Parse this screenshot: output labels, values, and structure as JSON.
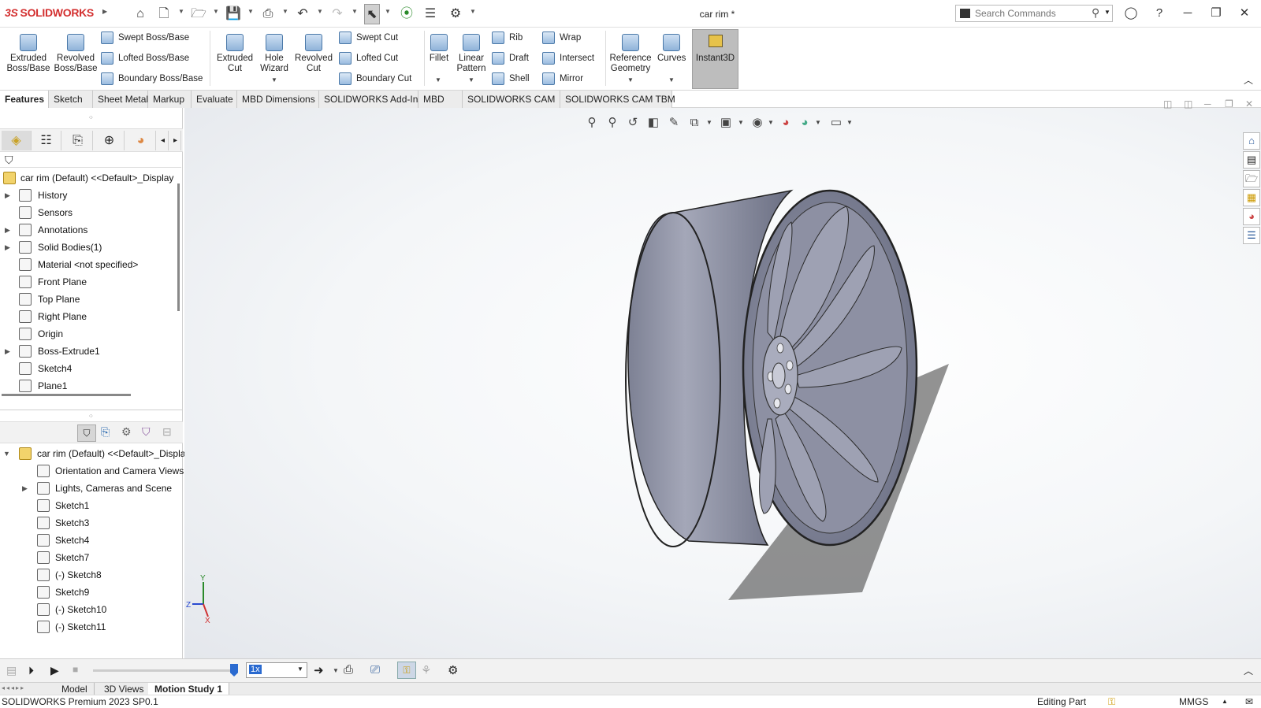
{
  "app": {
    "brand": "SOLIDWORKS",
    "document_title": "car rim *"
  },
  "search": {
    "placeholder": "Search Commands"
  },
  "ribbon": {
    "extruded_boss": "Extruded\nBoss/Base",
    "revolved_boss": "Revolved\nBoss/Base",
    "swept_boss": "Swept Boss/Base",
    "lofted_boss": "Lofted Boss/Base",
    "boundary_boss": "Boundary Boss/Base",
    "extruded_cut": "Extruded\nCut",
    "hole_wizard": "Hole\nWizard",
    "revolved_cut": "Revolved\nCut",
    "swept_cut": "Swept Cut",
    "lofted_cut": "Lofted Cut",
    "boundary_cut": "Boundary Cut",
    "fillet": "Fillet",
    "linear_pattern": "Linear\nPattern",
    "rib": "Rib",
    "draft": "Draft",
    "shell": "Shell",
    "wrap": "Wrap",
    "intersect": "Intersect",
    "mirror": "Mirror",
    "reference_geometry": "Reference\nGeometry",
    "curves": "Curves",
    "instant3d": "Instant3D"
  },
  "tabs": [
    "Features",
    "Sketch",
    "Sheet Metal",
    "Markup",
    "Evaluate",
    "MBD Dimensions",
    "SOLIDWORKS Add-Ins",
    "MBD",
    "SOLIDWORKS CAM",
    "SOLIDWORKS CAM TBM"
  ],
  "feature_tree": {
    "root": "car rim (Default) <<Default>_Display",
    "items": [
      "History",
      "Sensors",
      "Annotations",
      "Solid Bodies(1)",
      "Material <not specified>",
      "Front Plane",
      "Top Plane",
      "Right Plane",
      "Origin",
      "Boss-Extrude1",
      "Sketch4",
      "Plane1"
    ]
  },
  "motion_tree": {
    "root": "car rim (Default) <<Default>_Displa",
    "items": [
      "Orientation and Camera Views",
      "Lights, Cameras and Scene",
      "Sketch1",
      "Sketch3",
      "Sketch4",
      "Sketch7",
      "(-) Sketch8",
      "Sketch9",
      "(-) Sketch10",
      "(-) Sketch11"
    ]
  },
  "motion": {
    "speed": "1x"
  },
  "bottom_tabs": [
    "Model",
    "3D Views",
    "Motion Study 1"
  ],
  "status": {
    "version": "SOLIDWORKS Premium 2023 SP0.1",
    "mode": "Editing Part",
    "units": "MMGS"
  },
  "triad": {
    "y": "Y",
    "z": "Z",
    "x": "X"
  }
}
